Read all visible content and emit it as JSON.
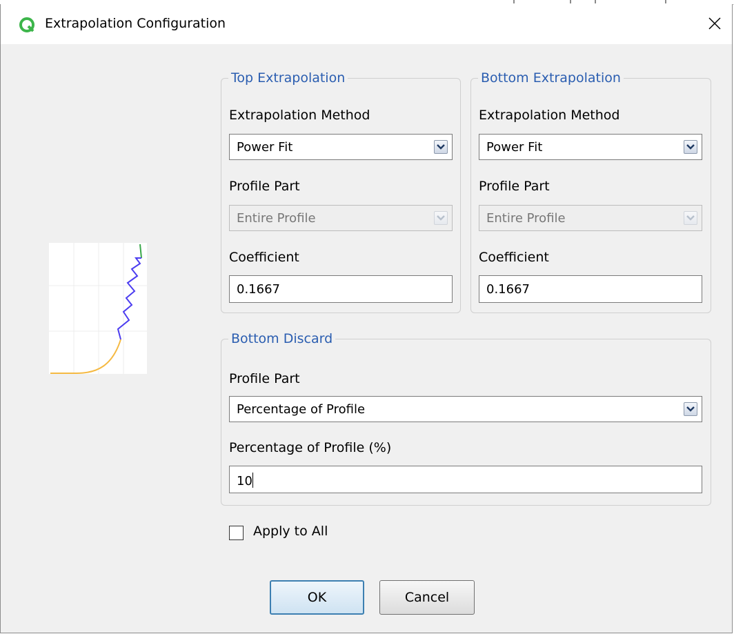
{
  "window": {
    "title": "Extrapolation Configuration",
    "close_icon": "close-icon",
    "app_icon": "q-logo-icon",
    "app_icon_color": "#3cb54a"
  },
  "top_extrapolation": {
    "legend": "Top Extrapolation",
    "method_label": "Extrapolation Method",
    "method_value": "Power Fit",
    "profile_part_label": "Profile Part",
    "profile_part_value": "Entire Profile",
    "coefficient_label": "Coefficient",
    "coefficient_value": "0.1667"
  },
  "bottom_extrapolation": {
    "legend": "Bottom Extrapolation",
    "method_label": "Extrapolation Method",
    "method_value": "Power Fit",
    "profile_part_label": "Profile Part",
    "profile_part_value": "Entire Profile",
    "coefficient_label": "Coefficient",
    "coefficient_value": "0.1667"
  },
  "bottom_discard": {
    "legend": "Bottom Discard",
    "profile_part_label": "Profile Part",
    "profile_part_value": "Percentage of Profile",
    "percentage_label": "Percentage of Profile (%)",
    "percentage_value": "10"
  },
  "apply_to_all": {
    "label": "Apply to All",
    "checked": false
  },
  "buttons": {
    "ok": "OK",
    "cancel": "Cancel"
  },
  "colors": {
    "legend_text": "#2a5db0",
    "preview_measured": "#4b3cf0",
    "preview_bottom_fit": "#f5b942",
    "preview_top_fit": "#3aa84a"
  }
}
